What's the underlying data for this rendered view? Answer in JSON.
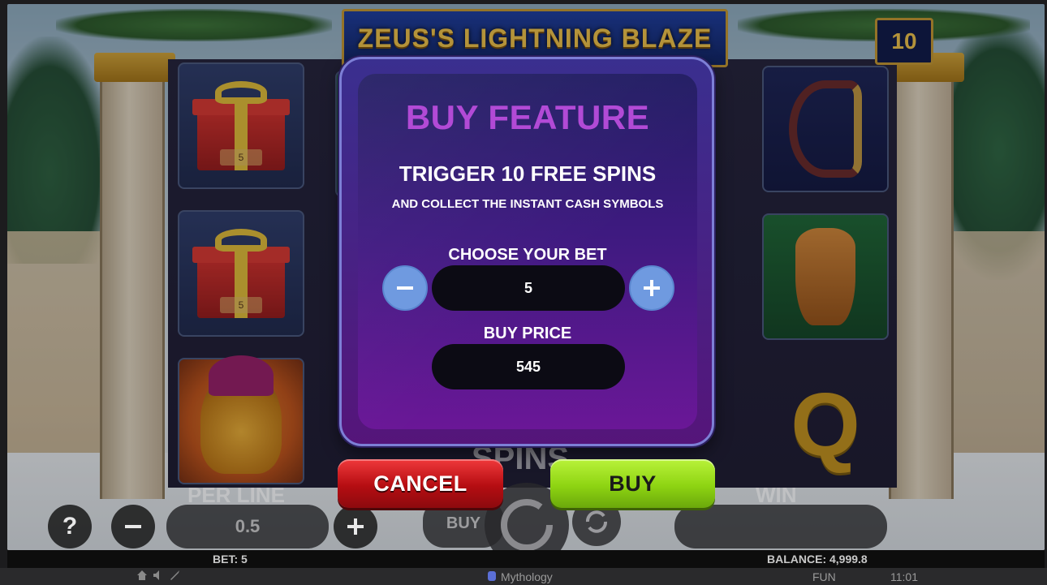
{
  "game": {
    "title": "ZEUS'S LIGHTNING BLAZE",
    "free_spins_counter": "10"
  },
  "reels": {
    "gift_value_top": "5",
    "gift_value_middle": "5",
    "q_symbol": "Q"
  },
  "modal": {
    "title": "BUY FEATURE",
    "line1": "TRIGGER 10 FREE SPINS",
    "line2": "AND COLLECT THE INSTANT CASH SYMBOLS",
    "bet_label": "CHOOSE YOUR BET",
    "bet_value": "5",
    "price_label": "BUY PRICE",
    "price_value": "545",
    "cancel_label": "CANCEL",
    "buy_label": "BUY"
  },
  "controls": {
    "per_line_label": "PER LINE",
    "per_line_value": "0.5",
    "help_label": "?",
    "buy_small_label": "BUY",
    "spins_label": "SPINS",
    "win_label": "WIN"
  },
  "info_bar": {
    "bet": "BET: 5",
    "balance": "BALANCE: 4,999.8"
  },
  "footer": {
    "brand": "Mythology",
    "mode": "FUN",
    "time": "11:01"
  },
  "colors": {
    "modal_title": "#b24ad6",
    "cancel": "#c8151a",
    "buy": "#9ee01c",
    "stepper": "#6f9ae0"
  }
}
